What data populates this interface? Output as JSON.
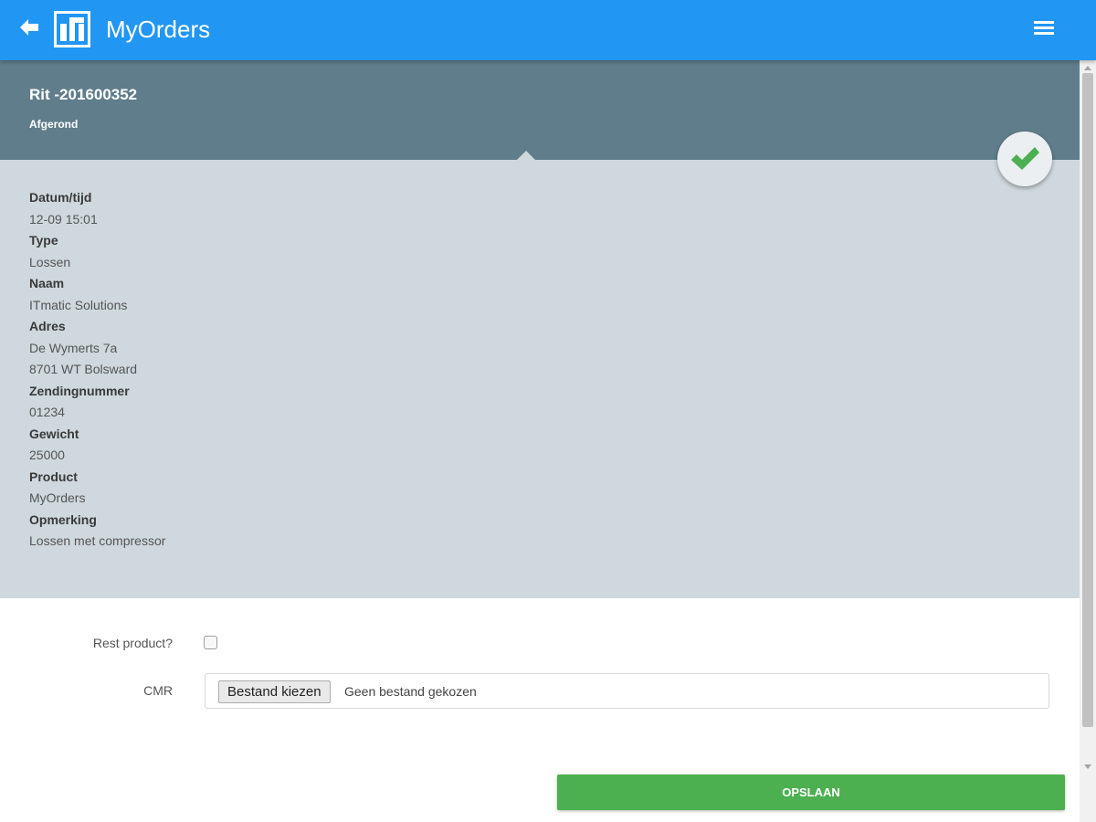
{
  "app": {
    "title": "MyOrders",
    "accent_color": "#2196f3",
    "back_icon": "arrow-left-icon",
    "menu_icon": "hamburger-menu-icon",
    "logo": "itmatic-logo"
  },
  "trip": {
    "title": "Rit -201600352",
    "status": "Afgerond",
    "status_icon": "checkmark-icon"
  },
  "details": [
    {
      "label": "Datum/tijd",
      "values": [
        "12-09 15:01"
      ]
    },
    {
      "label": "Type",
      "values": [
        "Lossen"
      ]
    },
    {
      "label": "Naam",
      "values": [
        "ITmatic Solutions"
      ]
    },
    {
      "label": "Adres",
      "values": [
        "De Wymerts 7a",
        "8701 WT Bolsward"
      ]
    },
    {
      "label": "Zendingnummer",
      "values": [
        "01234"
      ]
    },
    {
      "label": "Gewicht",
      "values": [
        "25000"
      ]
    },
    {
      "label": "Product",
      "values": [
        "MyOrders"
      ]
    },
    {
      "label": "Opmerking",
      "values": [
        "Lossen met compressor"
      ]
    }
  ],
  "form": {
    "rest_product_label": "Rest product?",
    "rest_product_checked": false,
    "cmr_label": "CMR",
    "file_button": "Bestand kiezen",
    "file_status": "Geen bestand gekozen",
    "save_label": "OPSLAAN"
  }
}
